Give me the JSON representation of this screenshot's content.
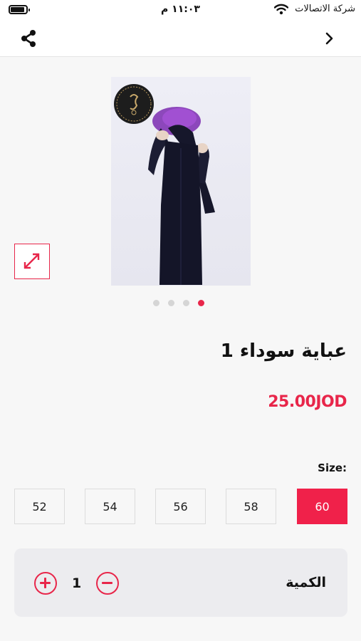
{
  "status_bar": {
    "time": "١١:٠٣ م",
    "carrier": "شركة الاتصالات"
  },
  "header": {
    "back_icon": "chevron-right-icon",
    "share_icon": "share-icon"
  },
  "gallery": {
    "image_count": 4,
    "active_index": 3,
    "expand_icon": "expand-icon"
  },
  "product": {
    "title": "عباية سوداء 1",
    "price": "25.00JOD"
  },
  "size": {
    "label": "Size:",
    "options": [
      "52",
      "54",
      "56",
      "58",
      "60"
    ],
    "selected": "60"
  },
  "quantity": {
    "label": "الكمية",
    "value": "1"
  },
  "colors": {
    "accent": "#e8264a",
    "background": "#f7f7f7"
  }
}
